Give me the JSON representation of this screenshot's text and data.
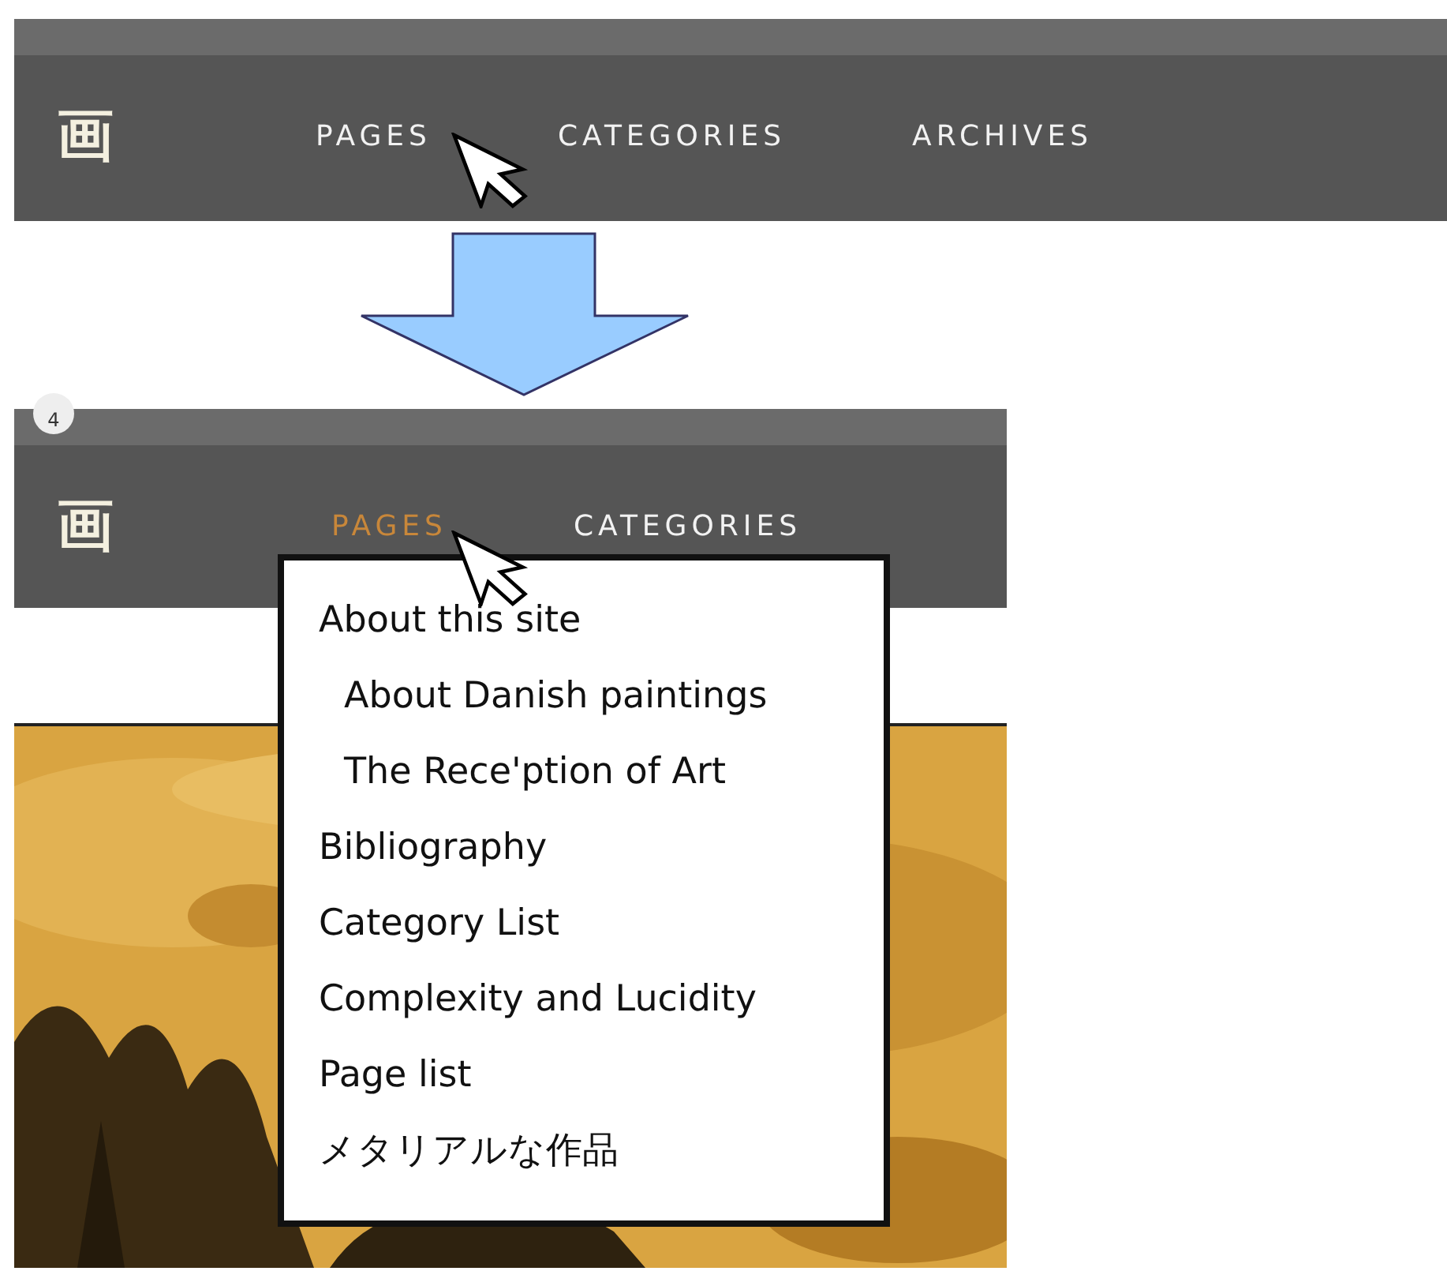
{
  "before": {
    "logo": "画",
    "nav": [
      {
        "label": "PAGES",
        "selected": false
      },
      {
        "label": "CATEGORIES",
        "selected": false
      },
      {
        "label": "ARCHIVES",
        "selected": false
      }
    ]
  },
  "after": {
    "step": "4",
    "logo": "画",
    "nav": [
      {
        "label": "PAGES",
        "selected": true
      },
      {
        "label": "CATEGORIES",
        "selected": false
      }
    ],
    "dropdown": {
      "items": [
        {
          "label": "About this site",
          "children": [
            {
              "label": "About Danish paintings"
            },
            {
              "label": "The Rece'ption of Art"
            }
          ]
        },
        {
          "label": "Bibliography"
        },
        {
          "label": "Category List"
        },
        {
          "label": "Complexity and Lucidity"
        },
        {
          "label": "Page list"
        },
        {
          "label": "メタリアルな作品"
        }
      ]
    }
  }
}
